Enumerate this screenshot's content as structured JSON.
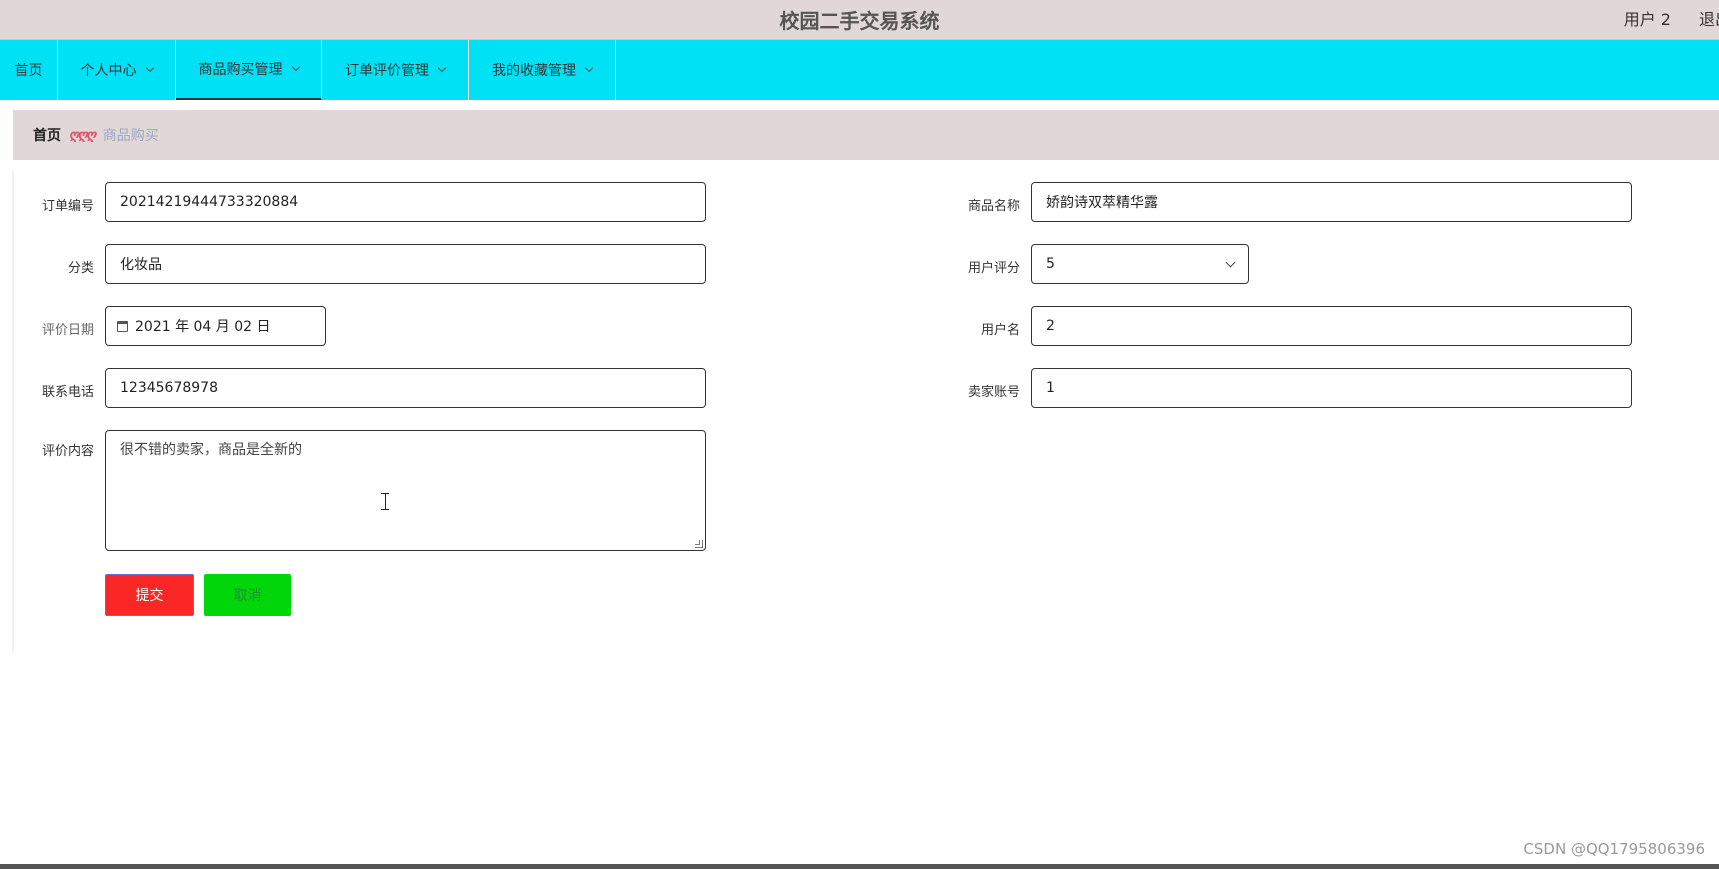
{
  "header": {
    "title": "校园二手交易系统",
    "user_label": "用户 2",
    "logout_label": "退出"
  },
  "nav": {
    "items": [
      {
        "label": "首页",
        "has_dropdown": false
      },
      {
        "label": "个人中心",
        "has_dropdown": true
      },
      {
        "label": "商品购买管理",
        "has_dropdown": true,
        "active": true
      },
      {
        "label": "订单评价管理",
        "has_dropdown": true
      },
      {
        "label": "我的收藏管理",
        "has_dropdown": true
      }
    ]
  },
  "breadcrumb": {
    "home": "首页",
    "separator": "ღღღ",
    "current": "商品购买"
  },
  "form": {
    "order_no": {
      "label": "订单编号",
      "value": "20214219444733320884"
    },
    "product_name": {
      "label": "商品名称",
      "value": "娇韵诗双萃精华露"
    },
    "category": {
      "label": "分类",
      "value": "化妆品"
    },
    "user_rating": {
      "label": "用户评分",
      "value": "5"
    },
    "review_date": {
      "label": "评价日期",
      "value": "2021 年 04 月 02 日"
    },
    "username": {
      "label": "用户名",
      "value": "2"
    },
    "phone": {
      "label": "联系电话",
      "value": "12345678978"
    },
    "seller_account": {
      "label": "卖家账号",
      "value": "1"
    },
    "review_content": {
      "label": "评价内容",
      "value": "很不错的卖家，商品是全新的"
    },
    "submit_label": "提交",
    "cancel_label": "取消"
  },
  "watermark": "CSDN @QQ1795806396",
  "colors": {
    "topbar": "#e0d7d6",
    "navbar": "#00e1f5",
    "submit": "#fb2727",
    "cancel": "#00d60a"
  }
}
